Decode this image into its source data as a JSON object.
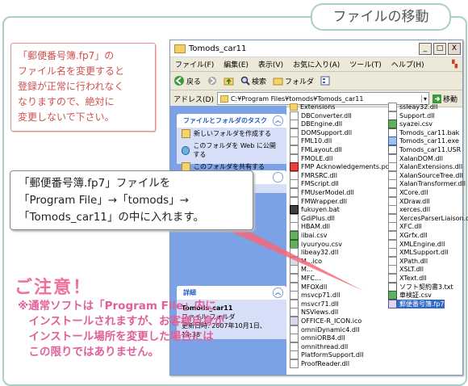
{
  "page_title": "ファイルの移動",
  "window": {
    "title": "Tomods_car11",
    "controls": {
      "minimize": "_",
      "maximize": "□",
      "close": "X"
    },
    "menu": [
      "ファイル(F)",
      "編集(E)",
      "表示(V)",
      "お気に入り(A)",
      "ツール(T)",
      "ヘルプ(H)"
    ],
    "toolbar": {
      "back": "戻る",
      "search": "検索",
      "folders": "フォルダ"
    },
    "address": {
      "label": "アドレス(D)",
      "value": "C:¥Program Files¥tomods¥Tomods_car11",
      "go": "移動"
    },
    "task_panel": {
      "title": "ファイルとフォルダのタスク",
      "items": [
        "新しいフォルダを作成する",
        "このフォルダを Web に公開する",
        "このフォルダを共有する"
      ]
    },
    "detail_panel": {
      "title": "詳細",
      "name": "Tomods_car11",
      "type": "ファイル フォルダ",
      "modified": "更新日時: 2007年10月1日、14:38"
    },
    "files_col1": [
      {
        "name": "Extensions",
        "icon": "folder"
      },
      {
        "name": "DBConverter.dll",
        "icon": "dll"
      },
      {
        "name": "DBEngine.dll",
        "icon": "dll"
      },
      {
        "name": "DOMSupport.dll",
        "icon": "dll"
      },
      {
        "name": "FML10.dll",
        "icon": "dll"
      },
      {
        "name": "FMLayout.dll",
        "icon": "dll"
      },
      {
        "name": "FMOLE.dll",
        "icon": "dll"
      },
      {
        "name": "FMP Acknowledgements.pdf",
        "icon": "pdf"
      },
      {
        "name": "FMRSRC.dll",
        "icon": "dll"
      },
      {
        "name": "FMScript.dll",
        "icon": "dll"
      },
      {
        "name": "FMUserModel.dll",
        "icon": "dll"
      },
      {
        "name": "FMWrapper.dll",
        "icon": "dll"
      },
      {
        "name": "fukuyen.bat",
        "icon": "bat"
      },
      {
        "name": "GdiPlus.dll",
        "icon": "dll"
      },
      {
        "name": "HBAM.dll",
        "icon": "dll"
      },
      {
        "name": "iibai.csv",
        "icon": "csv"
      },
      {
        "name": "iyuuryou.csv",
        "icon": "csv"
      },
      {
        "name": "libeay32.dll",
        "icon": "dll"
      },
      {
        "name": "M...ico",
        "icon": "gear"
      },
      {
        "name": "M...",
        "icon": "dll"
      },
      {
        "name": "MFC...",
        "icon": "dll"
      },
      {
        "name": "MFOXdll",
        "icon": "dll"
      },
      {
        "name": "msvcp71.dll",
        "icon": "dll"
      },
      {
        "name": "msvcr71.dll",
        "icon": "dll"
      },
      {
        "name": "NSViews.dll",
        "icon": "dll"
      },
      {
        "name": "OFFICE-R_ICON.ico",
        "icon": "gear"
      },
      {
        "name": "omniDynamic4.dll",
        "icon": "dll"
      },
      {
        "name": "omniORB4.dll",
        "icon": "dll"
      },
      {
        "name": "omnithread.dll",
        "icon": "dll"
      },
      {
        "name": "PlatformSupport.dll",
        "icon": "dll"
      },
      {
        "name": "ProofReader.dll",
        "icon": "dll"
      }
    ],
    "files_col2": [
      {
        "name": "ssleay32.dll",
        "icon": "dll"
      },
      {
        "name": "Support.dll",
        "icon": "dll"
      },
      {
        "name": "syazei.csv",
        "icon": "csv"
      },
      {
        "name": "Tomods_car11.bak",
        "icon": "txt"
      },
      {
        "name": "Tomods_car11.exe",
        "icon": "exe"
      },
      {
        "name": "Tomods_car11.USR",
        "icon": "txt"
      },
      {
        "name": "XalanDOM.dll",
        "icon": "dll"
      },
      {
        "name": "XalanExtensions.dll",
        "icon": "dll"
      },
      {
        "name": "XalanSourceTree.dll",
        "icon": "dll"
      },
      {
        "name": "XalanTransformer.dll",
        "icon": "dll"
      },
      {
        "name": "XCore.dll",
        "icon": "dll"
      },
      {
        "name": "XDraw.dll",
        "icon": "dll"
      },
      {
        "name": "xerces.dll",
        "icon": "dll"
      },
      {
        "name": "XercesParserLiaison.dll",
        "icon": "dll"
      },
      {
        "name": "XFC.dll",
        "icon": "dll"
      },
      {
        "name": "XGrfx.dll",
        "icon": "dll"
      },
      {
        "name": "XMLEngine.dll",
        "icon": "dll"
      },
      {
        "name": "XMLSupport.dll",
        "icon": "dll"
      },
      {
        "name": "XPath.dll",
        "icon": "dll"
      },
      {
        "name": "XSLT.dll",
        "icon": "dll"
      },
      {
        "name": "XText.dll",
        "icon": "dll"
      },
      {
        "name": "ソフト契約書3.txt",
        "icon": "txt"
      },
      {
        "name": "車検証.csv",
        "icon": "csv"
      },
      {
        "name": "郵便番号簿.fp7",
        "icon": "fp7",
        "selected": true
      }
    ]
  },
  "note_top": [
    "「郵便番号簿.fp7」の",
    "ファイル名を変更すると",
    "登録が正常に行われなく",
    "なりますので、絶対に",
    "変更しないで下さい。"
  ],
  "note_move": [
    "「郵便番号簿.fp7」ファイルを",
    "「Program File」→「tomods」→",
    "「Tomods_car11」の中に入れます。"
  ],
  "warning": {
    "title": "ご注意！",
    "lines": [
      "※通常ソフトは「Program File」内に",
      "　インストールされますが、お客様自身が",
      "　インストール場所を変更した場合には",
      "　この限りではありません。"
    ]
  }
}
